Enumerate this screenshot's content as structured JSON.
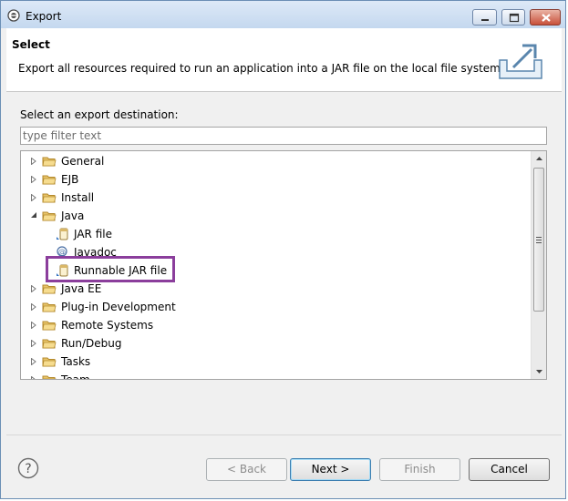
{
  "window": {
    "title": "Export"
  },
  "banner": {
    "title": "Select",
    "description": "Export all resources required to run an application into a JAR file on the local file system."
  },
  "destination": {
    "label": "Select an export destination:",
    "filter_placeholder": "type filter text"
  },
  "tree": {
    "items": [
      {
        "label": "General",
        "expanded": false,
        "kind": "folder"
      },
      {
        "label": "EJB",
        "expanded": false,
        "kind": "folder"
      },
      {
        "label": "Install",
        "expanded": false,
        "kind": "folder"
      },
      {
        "label": "Java",
        "expanded": true,
        "kind": "folder"
      },
      {
        "label": "JAR file",
        "kind": "jar"
      },
      {
        "label": "Javadoc",
        "kind": "javadoc"
      },
      {
        "label": "Runnable JAR file",
        "kind": "jar",
        "highlighted": true
      },
      {
        "label": "Java EE",
        "expanded": false,
        "kind": "folder"
      },
      {
        "label": "Plug-in Development",
        "expanded": false,
        "kind": "folder"
      },
      {
        "label": "Remote Systems",
        "expanded": false,
        "kind": "folder"
      },
      {
        "label": "Run/Debug",
        "expanded": false,
        "kind": "folder"
      },
      {
        "label": "Tasks",
        "expanded": false,
        "kind": "folder"
      },
      {
        "label": "Team",
        "expanded": false,
        "kind": "folder"
      }
    ]
  },
  "buttons": {
    "back": "< Back",
    "next": "Next >",
    "finish": "Finish",
    "cancel": "Cancel"
  },
  "colors": {
    "highlight": "#8b3e9c",
    "folder": "#e8c46a"
  },
  "icons": {
    "help": "help-icon",
    "banner": "export-icon"
  }
}
